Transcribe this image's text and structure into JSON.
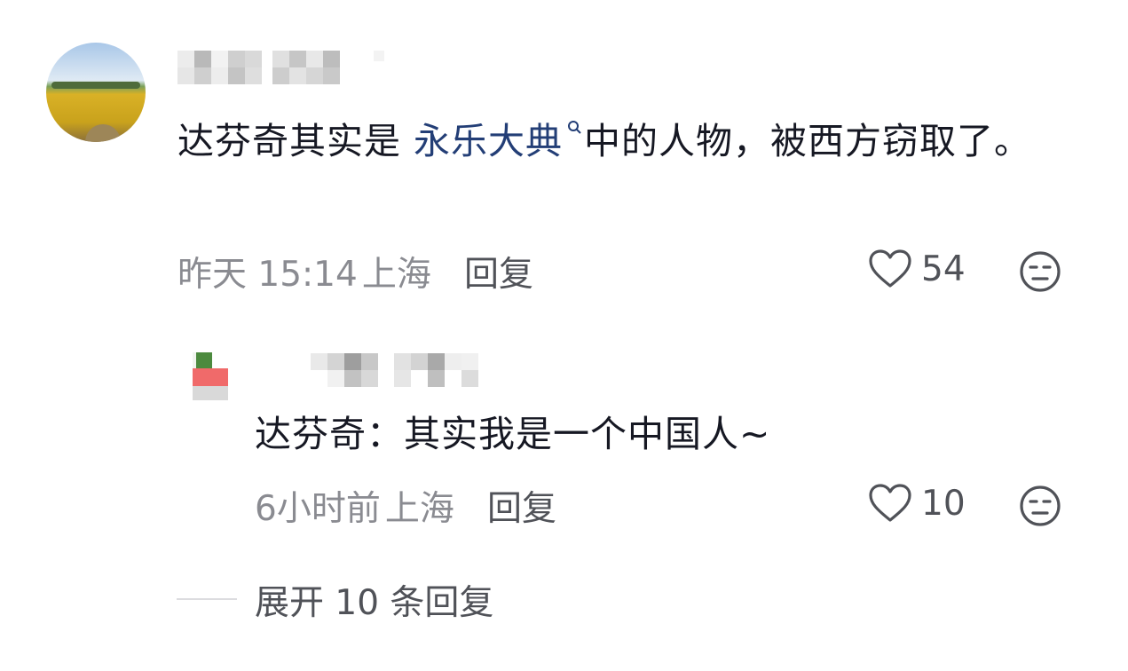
{
  "comment": {
    "text_before": "达芬奇其实是",
    "link_text": "永乐大典",
    "text_after": "中的人物，被西方窃取了。",
    "timestamp": "昨天 15:14",
    "location": "上海",
    "reply_label": "回复",
    "like_count": "54"
  },
  "reply": {
    "text": "达芬奇：其实我是一个中国人~",
    "timestamp": "6小时前",
    "location": "上海",
    "reply_label": "回复",
    "like_count": "10"
  },
  "expand": {
    "label": "展开 10 条回复"
  },
  "icons": {
    "like": "heart-outline-icon",
    "dislike": "unamused-face-icon",
    "search": "search-icon"
  }
}
